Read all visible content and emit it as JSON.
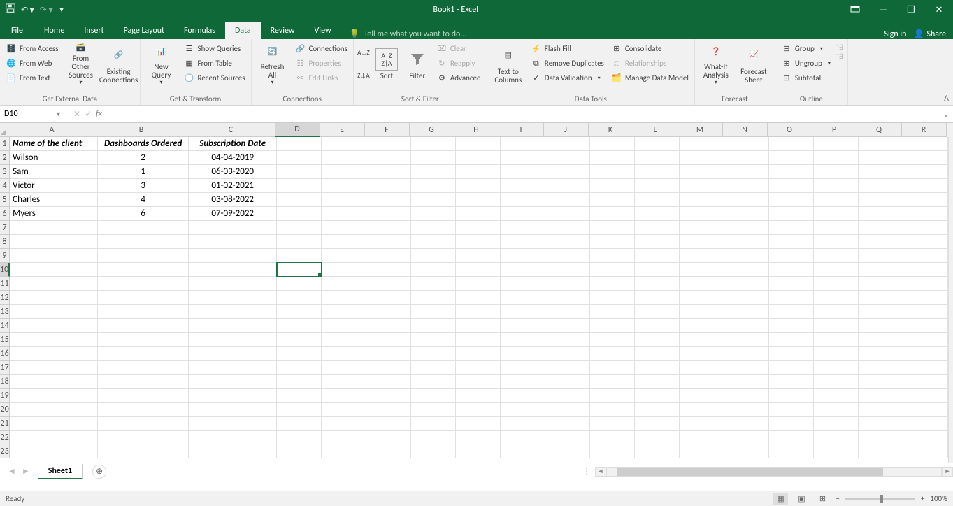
{
  "title": "Book1 - Excel",
  "tabs": {
    "file": "File",
    "home": "Home",
    "insert": "Insert",
    "pagelayout": "Page Layout",
    "formulas": "Formulas",
    "data": "Data",
    "review": "Review",
    "view": "View",
    "tellme": "Tell me what you want to do...",
    "signin": "Sign in",
    "share": "Share"
  },
  "ribbon": {
    "getexternal": {
      "label": "Get External Data",
      "access": "From Access",
      "web": "From Web",
      "text": "From Text",
      "other": "From Other Sources",
      "existing": "Existing Connections"
    },
    "gettransform": {
      "label": "Get & Transform",
      "newquery": "New Query",
      "showqueries": "Show Queries",
      "fromtable": "From Table",
      "recent": "Recent Sources"
    },
    "connections": {
      "label": "Connections",
      "refresh": "Refresh All",
      "conn": "Connections",
      "props": "Properties",
      "editlinks": "Edit Links"
    },
    "sortfilter": {
      "label": "Sort & Filter",
      "sort": "Sort",
      "filter": "Filter",
      "clear": "Clear",
      "reapply": "Reapply",
      "advanced": "Advanced"
    },
    "datatools": {
      "label": "Data Tools",
      "ttc": "Text to Columns",
      "flash": "Flash Fill",
      "dup": "Remove Duplicates",
      "valid": "Data Validation",
      "consol": "Consolidate",
      "rel": "Relationships",
      "mdm": "Manage Data Model"
    },
    "forecast": {
      "label": "Forecast",
      "wia": "What-If Analysis",
      "fs": "Forecast Sheet"
    },
    "outline": {
      "label": "Outline",
      "group": "Group",
      "ungroup": "Ungroup",
      "subtotal": "Subtotal"
    }
  },
  "namebox": "D10",
  "columns": [
    "A",
    "B",
    "C",
    "D",
    "E",
    "F",
    "G",
    "H",
    "I",
    "J",
    "K",
    "L",
    "M",
    "N",
    "O",
    "P",
    "Q",
    "R"
  ],
  "rows": 23,
  "selected": {
    "row": 10,
    "col": "D"
  },
  "sheet": "Sheet1",
  "status": "Ready",
  "zoom": "100%",
  "chart_data": {
    "type": "table",
    "headers": [
      "Name of the client",
      "Dashboards Ordered",
      "Subscription Date"
    ],
    "rows": [
      [
        "Wilson",
        "2",
        "04-04-2019"
      ],
      [
        "Sam",
        "1",
        "06-03-2020"
      ],
      [
        "Victor",
        "3",
        "01-02-2021"
      ],
      [
        "Charles",
        "4",
        "03-08-2022"
      ],
      [
        "Myers",
        "6",
        "07-09-2022"
      ]
    ]
  }
}
